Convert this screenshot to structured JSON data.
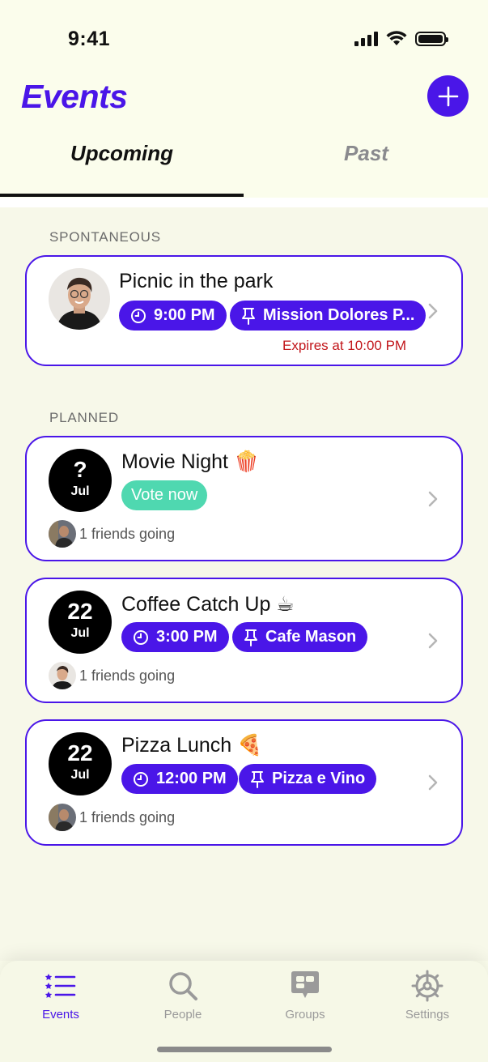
{
  "status_bar": {
    "time": "9:41",
    "icons": [
      "signal-icon",
      "wifi-icon",
      "battery-icon"
    ]
  },
  "header": {
    "title": "Events",
    "add_icon": "plus-icon"
  },
  "tabs": [
    {
      "label": "Upcoming",
      "active": true
    },
    {
      "label": "Past",
      "active": false
    }
  ],
  "sections": {
    "spontaneous": {
      "label": "SPONTANEOUS",
      "events": [
        {
          "title": "Picnic in the park",
          "time": "9:00 PM",
          "location": "Mission Dolores P...",
          "expires": "Expires at 10:00 PM"
        }
      ]
    },
    "planned": {
      "label": "PLANNED",
      "events": [
        {
          "title": "Movie Night 🍿",
          "day": "?",
          "month": "Jul",
          "vote_label": "Vote now",
          "friends": "1 friends going"
        },
        {
          "title": "Coffee Catch Up ☕",
          "day": "22",
          "month": "Jul",
          "time": "3:00 PM",
          "location": "Cafe Mason",
          "friends": "1 friends going"
        },
        {
          "title": "Pizza Lunch 🍕",
          "day": "22",
          "month": "Jul",
          "time": "12:00 PM",
          "location": "Pizza e Vino",
          "friends": "1 friends going"
        }
      ]
    }
  },
  "bottom_nav": [
    {
      "label": "Events",
      "icon": "events-list-icon",
      "active": true
    },
    {
      "label": "People",
      "icon": "search-icon",
      "active": false
    },
    {
      "label": "Groups",
      "icon": "groups-chat-icon",
      "active": false
    },
    {
      "label": "Settings",
      "icon": "gear-icon",
      "active": false
    }
  ],
  "colors": {
    "accent": "#4a16e8",
    "background": "#fbfdec",
    "vote": "#4fd8b0",
    "expires": "#c2161b"
  }
}
